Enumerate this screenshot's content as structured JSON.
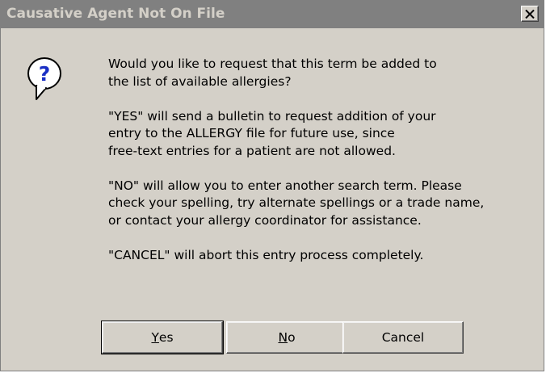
{
  "window": {
    "title": "Causative Agent Not On File",
    "close_icon": "close-icon",
    "close_glyph": "×"
  },
  "icon": {
    "name": "question-icon",
    "glyph": "?",
    "color": "#1a2fc4"
  },
  "message": {
    "paragraphs": [
      "Would you like to request that this term be added to\nthe list of available allergies?",
      "\"YES\" will send a bulletin to request addition of your\nentry to the ALLERGY file for future use, since\nfree-text entries for a patient are not allowed.",
      "\"NO\" will allow you to enter another search term.  Please\ncheck your spelling, try alternate spellings or a trade name,\nor contact your allergy coordinator for assistance.",
      "\"CANCEL\" will abort this entry process completely."
    ]
  },
  "buttons": {
    "yes": {
      "mnemonic": "Y",
      "rest": "es"
    },
    "no": {
      "mnemonic": "N",
      "rest": "o"
    },
    "cancel": {
      "label": "Cancel"
    }
  },
  "colors": {
    "dialog_bg": "#d4d0c8",
    "titlebar_bg": "#808080",
    "titlebar_text": "#d4d0c8"
  }
}
